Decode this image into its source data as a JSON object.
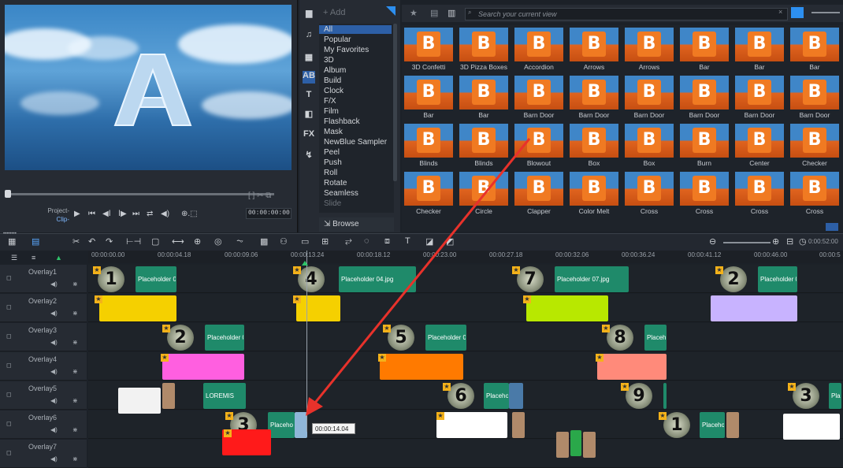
{
  "library": {
    "add_label": "Add",
    "categories": [
      "All",
      "Popular",
      "My Favorites",
      "3D",
      "Album",
      "Build",
      "Clock",
      "F/X",
      "Film",
      "Flashback",
      "Mask",
      "NewBlue Sampler",
      "Peel",
      "Push",
      "Roll",
      "Rotate",
      "Seamless",
      "Slide"
    ],
    "browse_label": "Browse",
    "search_placeholder": "Search your current view",
    "thumbnails": [
      "3D Confetti",
      "3D Pizza Boxes",
      "Accordion",
      "Arrows",
      "Arrows",
      "Bar",
      "Bar",
      "Bar",
      "Bar",
      "Bar",
      "Barn Door",
      "Barn Door",
      "Barn Door",
      "Barn Door",
      "Barn Door",
      "Barn Door",
      "Blinds",
      "Blinds",
      "Blowout",
      "Box",
      "Box",
      "Burn",
      "Center",
      "Checker",
      "Checker",
      "Circle",
      "Clapper",
      "Color Melt",
      "Cross",
      "Cross",
      "Cross",
      "Cross"
    ]
  },
  "preview": {
    "project_label": "Project-",
    "clip_label": "Clip-",
    "timecode": "00:00:00:00"
  },
  "timeline": {
    "duration": "0:00:52:00",
    "ruler": [
      "00:00:00.00",
      "00:00:04.18",
      "00:00:09.06",
      "00:00:13.24",
      "00:00:18.12",
      "00:00:23.00",
      "00:00:27.18",
      "00:00:32.06",
      "00:00:36.24",
      "00:00:41.12",
      "00:00:46.00",
      "00:00:5"
    ],
    "tracks": [
      "Overlay1",
      "Overlay2",
      "Overlay3",
      "Overlay4",
      "Overlay5",
      "Overlay6",
      "Overlay7"
    ],
    "clips": {
      "c1": "Placeholder 0",
      "c4": "Placeholder 04.jpg",
      "c7": "Placeholder 07.jpg",
      "c2a": "Placeholder 0",
      "c2b": "Placeholder 0",
      "c5": "Placeholder 0",
      "c8": "Placeho",
      "loremis": "LOREMIS",
      "c6": "Placeho",
      "c3a": "Placeho",
      "c1b": "Placeho",
      "pla": "Pla"
    },
    "numbers": {
      "n1": "1",
      "n4": "4",
      "n7": "7",
      "n2": "2",
      "n2b": "2",
      "n5": "5",
      "n8": "8",
      "n6": "6",
      "n9": "9",
      "n3": "3",
      "n3b": "3",
      "n1b": "1"
    },
    "tooltip": "00:00:14.04"
  },
  "colors": {
    "accent": "#2d5fa6",
    "annotation": "#e8322b"
  }
}
